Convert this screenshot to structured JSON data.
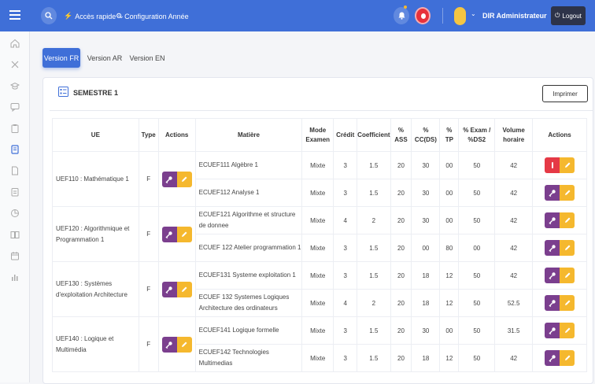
{
  "header": {
    "quick_access": "Accès rapide",
    "config": "Configuration Année",
    "username": "DIR Administrateur",
    "logout": "Logout"
  },
  "tabs": [
    {
      "label": "Version FR",
      "active": true
    },
    {
      "label": "Version AR",
      "active": false
    },
    {
      "label": "Version EN",
      "active": false
    }
  ],
  "semester": {
    "title": "SEMESTRE 1"
  },
  "print_label": "Imprimer",
  "colors": {
    "primary": "#3f6fd8",
    "purple": "#7b3f8e",
    "yellow": "#f5b82e",
    "red": "#e53946",
    "dark": "#2d3349"
  },
  "table": {
    "headers": {
      "ue": "UE",
      "type": "Type",
      "actions": "Actions",
      "matiere": "Matière",
      "mode1": "Mode",
      "mode2": "Examen",
      "credit": "Crédit",
      "coef": "Coefficient",
      "ass1": "%",
      "ass2": "ASS",
      "cc1": "%",
      "cc2": "CC(DS)",
      "tp1": "%",
      "tp2": "TP",
      "exam1": "% Exam /",
      "exam2": "%DS2",
      "vol1": "Volume",
      "vol2": "horaire",
      "actions2": "Actions"
    },
    "groups": [
      {
        "ue": "UEF110 : Mathématique 1",
        "type": "F",
        "rows": [
          {
            "matiere": "ECUEF111 Algèbre 1",
            "mode": "Mixte",
            "credit": "3",
            "coef": "1.5",
            "ass": "20",
            "cc": "30",
            "tp": "00",
            "exam": "50",
            "volume": "42",
            "delete": true
          },
          {
            "matiere": "ECUEF112 Analyse 1",
            "mode": "Mixte",
            "credit": "3",
            "coef": "1.5",
            "ass": "20",
            "cc": "30",
            "tp": "00",
            "exam": "50",
            "volume": "42",
            "delete": false
          }
        ]
      },
      {
        "ue": "UEF120 : Algorithmique et Programmation 1",
        "type": "F",
        "rows": [
          {
            "matiere": "ECUEF121 Algorithme et structure de donnee",
            "mode": "Mixte",
            "credit": "4",
            "coef": "2",
            "ass": "20",
            "cc": "30",
            "tp": "00",
            "exam": "50",
            "volume": "42",
            "delete": false
          },
          {
            "matiere": "ECUEF 122 Atelier programmation 1",
            "mode": "Mixte",
            "credit": "3",
            "coef": "1.5",
            "ass": "20",
            "cc": "00",
            "tp": "80",
            "exam": "00",
            "volume": "42",
            "delete": false
          }
        ]
      },
      {
        "ue": "UEF130 : Systèmes d'exploitation Architecture",
        "type": "F",
        "rows": [
          {
            "matiere": "ECUEF131 Systeme exploitation 1",
            "mode": "Mixte",
            "credit": "3",
            "coef": "1.5",
            "ass": "20",
            "cc": "18",
            "tp": "12",
            "exam": "50",
            "volume": "42",
            "delete": false
          },
          {
            "matiere": "ECUEF 132 Systemes Logiques Architecture des ordinateurs",
            "mode": "Mixte",
            "credit": "4",
            "coef": "2",
            "ass": "20",
            "cc": "18",
            "tp": "12",
            "exam": "50",
            "volume": "52.5",
            "delete": false
          }
        ]
      },
      {
        "ue": "UEF140 : Logique et Multimédia",
        "type": "F",
        "rows": [
          {
            "matiere": "ECUEF141 Logique formelle",
            "mode": "Mixte",
            "credit": "3",
            "coef": "1.5",
            "ass": "20",
            "cc": "30",
            "tp": "00",
            "exam": "50",
            "volume": "31.5",
            "delete": false
          },
          {
            "matiere": "ECUEF142 Technologies Multimedias",
            "mode": "Mixte",
            "credit": "3",
            "coef": "1.5",
            "ass": "20",
            "cc": "18",
            "tp": "12",
            "exam": "50",
            "volume": "42",
            "delete": false
          }
        ]
      }
    ]
  }
}
